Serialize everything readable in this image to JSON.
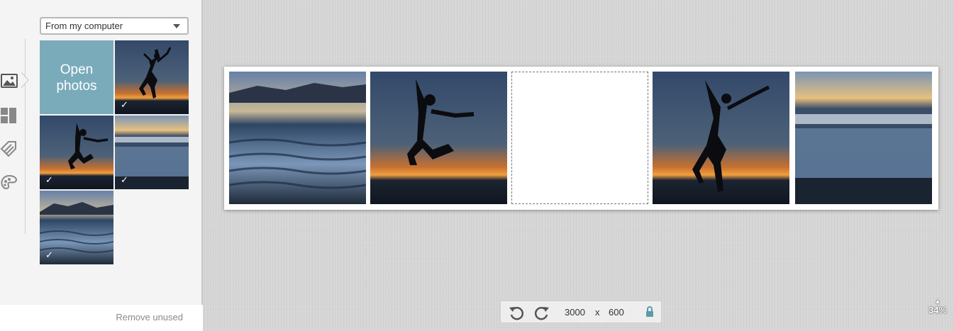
{
  "sidebar": {
    "source_select": "From my computer",
    "open_photos": "Open photos",
    "remove_unused": "Remove unused",
    "tools": [
      "photos-icon",
      "layouts-icon",
      "tags-icon",
      "palette-icon"
    ],
    "check_mark": "✓"
  },
  "canvas": {
    "width_value": "3000",
    "times_sign": "x",
    "height_value": "600",
    "zoom_label": "34%",
    "zoom_arrow": "▲"
  }
}
